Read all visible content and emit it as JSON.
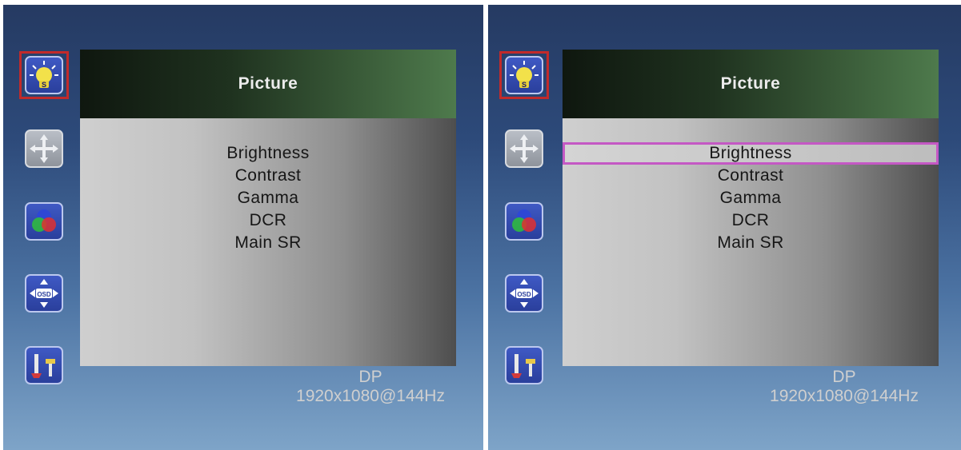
{
  "left_screen": {
    "sidebar": {
      "icons": [
        {
          "name": "picture-bulb-icon",
          "selected": true
        },
        {
          "name": "position-arrows-icon",
          "selected": false
        },
        {
          "name": "color-circles-icon",
          "selected": false
        },
        {
          "name": "osd-position-icon",
          "selected": false
        },
        {
          "name": "tools-setup-icon",
          "selected": false
        }
      ]
    },
    "panel": {
      "title": "Picture",
      "items": [
        "Brightness",
        "Contrast",
        "Gamma",
        "DCR",
        "Main SR"
      ],
      "highlighted_index": null
    },
    "status": {
      "input_source": "DP",
      "resolution": "1920x1080@144Hz"
    }
  },
  "right_screen": {
    "sidebar": {
      "icons": [
        {
          "name": "picture-bulb-icon",
          "selected": true
        },
        {
          "name": "position-arrows-icon",
          "selected": false
        },
        {
          "name": "color-circles-icon",
          "selected": false
        },
        {
          "name": "osd-position-icon",
          "selected": false
        },
        {
          "name": "tools-setup-icon",
          "selected": false
        }
      ]
    },
    "panel": {
      "title": "Picture",
      "items": [
        "Brightness",
        "Contrast",
        "Gamma",
        "DCR",
        "Main SR"
      ],
      "highlighted_index": 0
    },
    "status": {
      "input_source": "DP",
      "resolution": "1920x1080@144Hz"
    }
  },
  "colors": {
    "selected_icon_border": "#c22a2a",
    "highlight_border": "#c458c4",
    "header_green": "#4e7a4c"
  }
}
